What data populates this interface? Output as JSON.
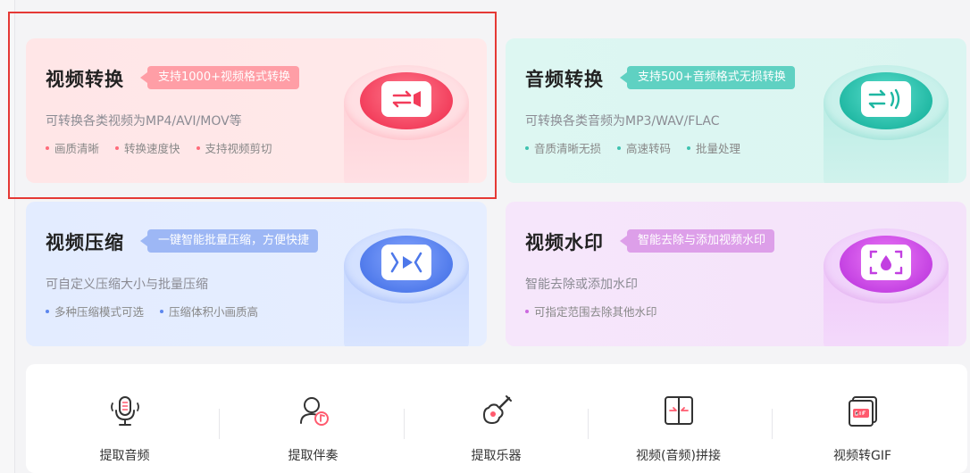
{
  "cards": {
    "video_convert": {
      "title": "视频转换",
      "tag": "支持1000+视频格式转换",
      "desc": "可转换各类视频为MP4/AVI/MOV等",
      "features": [
        "画质清晰",
        "转换速度快",
        "支持视频剪切"
      ],
      "icon": "video-convert-icon",
      "accent": "#f23c5a"
    },
    "audio_convert": {
      "title": "音频转换",
      "tag": "支持500+音频格式无损转换",
      "desc": "可转换各类音频为MP3/WAV/FLAC",
      "features": [
        "音质清晰无损",
        "高速转码",
        "批量处理"
      ],
      "icon": "audio-convert-icon",
      "accent": "#1fb7a2"
    },
    "video_compress": {
      "title": "视频压缩",
      "tag": "一键智能批量压缩，方便快捷",
      "desc": "可自定义压缩大小与批量压缩",
      "features": [
        "多种压缩模式可选",
        "压缩体积小画质高"
      ],
      "icon": "video-compress-icon",
      "accent": "#4d78ea"
    },
    "video_watermark": {
      "title": "视频水印",
      "tag": "智能去除与添加视频水印",
      "desc": "智能去除或添加水印",
      "features": [
        "可指定范围去除其他水印"
      ],
      "icon": "watermark-icon",
      "accent": "#c23fe1"
    }
  },
  "tools": [
    {
      "label": "提取音频",
      "icon": "microphone-icon"
    },
    {
      "label": "提取伴奏",
      "icon": "singer-icon"
    },
    {
      "label": "提取乐器",
      "icon": "guitar-icon"
    },
    {
      "label": "视频(音频)拼接",
      "icon": "merge-icon"
    },
    {
      "label": "视频转GIF",
      "icon": "gif-icon"
    }
  ],
  "highlight_color": "#e53935"
}
